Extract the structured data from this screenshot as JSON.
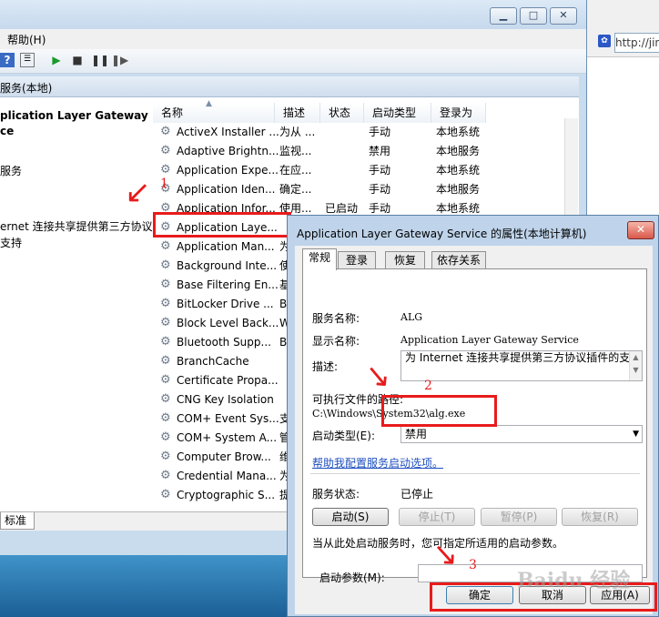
{
  "main_window": {
    "menu_help": "帮助(H)",
    "panel_header": "服务(本地)",
    "left_pane": {
      "service_name": "plication Layer Gateway\nce",
      "action_link": "服务",
      "description": "ernet 连接共享提供第三方协议\n支持"
    },
    "columns": [
      "名称",
      "描述",
      "状态",
      "启动类型",
      "登录为"
    ],
    "rows": [
      {
        "name": "ActiveX Installer ...",
        "desc": "为从 ...",
        "status": "",
        "startup": "手动",
        "logon": "本地系统"
      },
      {
        "name": "Adaptive Brightn...",
        "desc": "监视...",
        "status": "",
        "startup": "禁用",
        "logon": "本地服务"
      },
      {
        "name": "Application Expe...",
        "desc": "在应...",
        "status": "",
        "startup": "手动",
        "logon": "本地系统"
      },
      {
        "name": "Application Iden...",
        "desc": "确定...",
        "status": "",
        "startup": "手动",
        "logon": "本地服务"
      },
      {
        "name": "Application Infor...",
        "desc": "使用...",
        "status": "已启动",
        "startup": "手动",
        "logon": "本地系统"
      },
      {
        "name": "Application Laye...",
        "desc": "",
        "status": "",
        "startup": "",
        "logon": ""
      },
      {
        "name": "Application Man...",
        "desc": "为",
        "status": "",
        "startup": "",
        "logon": ""
      },
      {
        "name": "Background Inte...",
        "desc": "使",
        "status": "",
        "startup": "",
        "logon": ""
      },
      {
        "name": "Base Filtering En...",
        "desc": "基",
        "status": "",
        "startup": "",
        "logon": ""
      },
      {
        "name": "BitLocker Drive ...",
        "desc": "B",
        "status": "",
        "startup": "",
        "logon": ""
      },
      {
        "name": "Block Level Back...",
        "desc": "W",
        "status": "",
        "startup": "",
        "logon": ""
      },
      {
        "name": "Bluetooth Supp...",
        "desc": "B",
        "status": "",
        "startup": "",
        "logon": ""
      },
      {
        "name": "BranchCache",
        "desc": "",
        "status": "",
        "startup": "",
        "logon": ""
      },
      {
        "name": "Certificate Propa...",
        "desc": "",
        "status": "",
        "startup": "",
        "logon": ""
      },
      {
        "name": "CNG Key Isolation",
        "desc": "",
        "status": "",
        "startup": "",
        "logon": ""
      },
      {
        "name": "COM+ Event Sys...",
        "desc": "支",
        "status": "",
        "startup": "",
        "logon": ""
      },
      {
        "name": "COM+ System A...",
        "desc": "管",
        "status": "",
        "startup": "",
        "logon": ""
      },
      {
        "name": "Computer Brow...",
        "desc": "维",
        "status": "",
        "startup": "",
        "logon": ""
      },
      {
        "name": "Credential Mana...",
        "desc": "为",
        "status": "",
        "startup": "",
        "logon": ""
      },
      {
        "name": "Cryptographic S...",
        "desc": "提",
        "status": "",
        "startup": "",
        "logon": ""
      }
    ],
    "bottom_tab": "标准"
  },
  "browser": {
    "address": "http://jin"
  },
  "annotations": {
    "n1": "1",
    "n2": "2",
    "n3": "3"
  },
  "dialog": {
    "title": "Application Layer Gateway Service 的属性(本地计算机)",
    "close": "✕",
    "tabs": [
      "常规",
      "登录",
      "恢复",
      "依存关系"
    ],
    "service_name_label": "服务名称:",
    "service_name_value": "ALG",
    "display_name_label": "显示名称:",
    "display_name_value": "Application Layer Gateway Service",
    "description_label": "描述:",
    "description_value": "为 Internet 连接共享提供第三方协议插件的支持",
    "exe_path_label": "可执行文件的路径:",
    "exe_path_value": "C:\\Windows\\System32\\alg.exe",
    "startup_type_label": "启动类型(E):",
    "startup_type_value": "禁用",
    "help_link": "帮助我配置服务启动选项。",
    "service_status_label": "服务状态:",
    "service_status_value": "已停止",
    "btn_start": "启动(S)",
    "btn_stop": "停止(T)",
    "btn_pause": "暂停(P)",
    "btn_resume": "恢复(R)",
    "start_params_hint": "当从此处启动服务时，您可指定所适用的启动参数。",
    "start_params_label": "启动参数(M):",
    "btn_ok": "确定",
    "btn_cancel": "取消",
    "btn_apply": "应用(A)"
  },
  "watermark": "Baidu 经验"
}
